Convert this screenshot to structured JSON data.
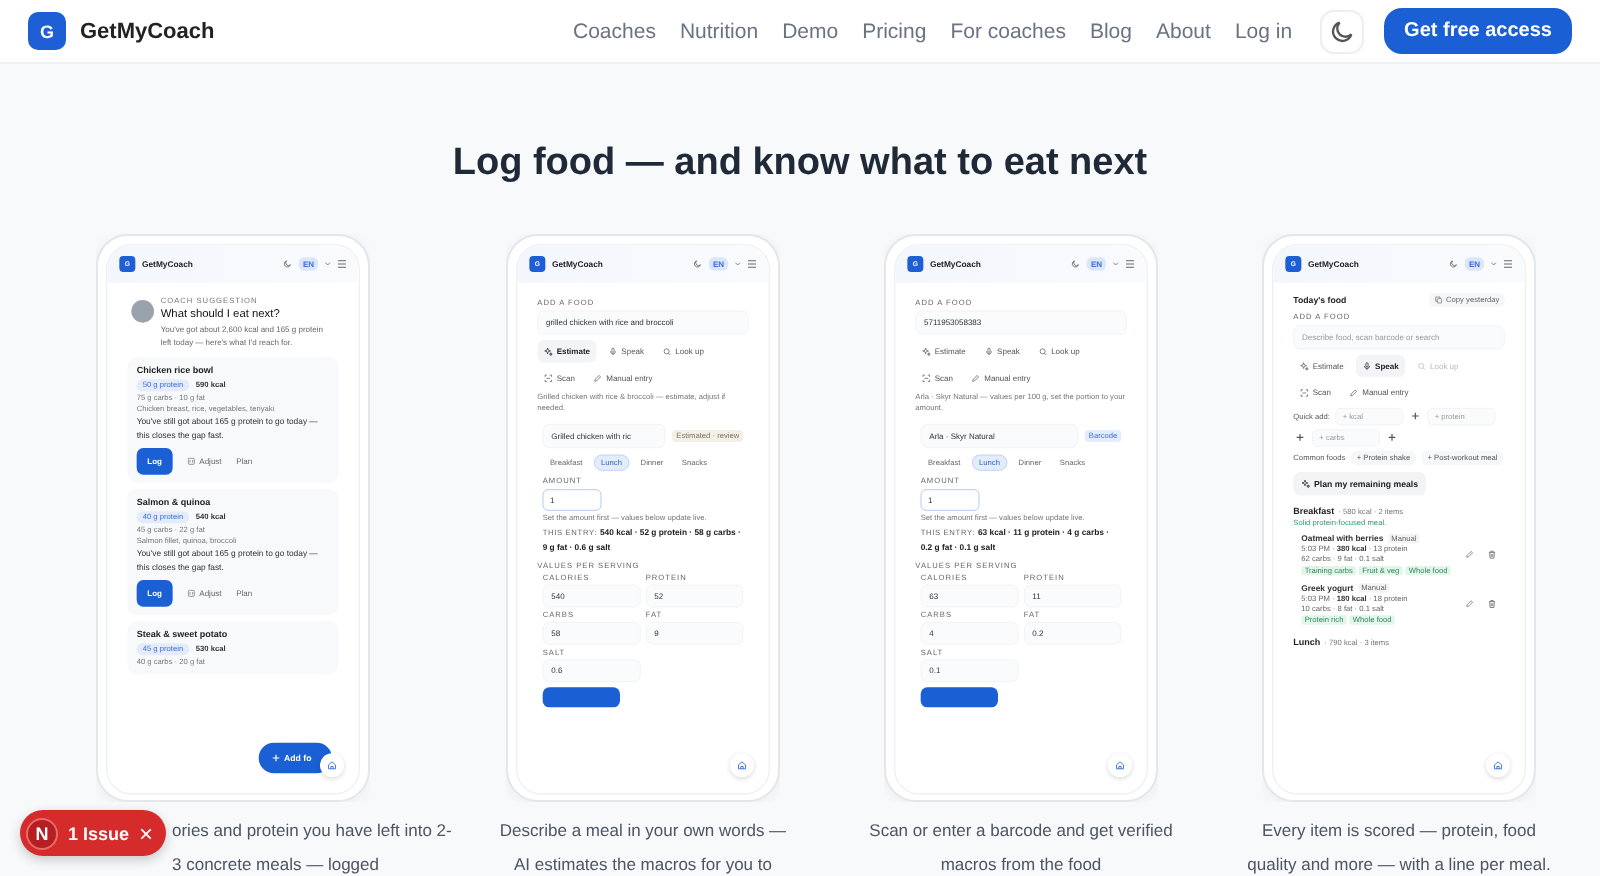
{
  "nav": {
    "logo": "G",
    "brand": "GetMyCoach",
    "links": [
      "Coaches",
      "Nutrition",
      "Demo",
      "Pricing",
      "For coaches",
      "Blog",
      "About",
      "Log in"
    ],
    "cta": "Get free access"
  },
  "heading": "Log food — and know what to eat next",
  "phones": [
    {
      "logo": "G",
      "brand": "GetMyCoach",
      "lang": "EN",
      "caption": "ories and protein you have left into 2-3 concrete meals — logged",
      "fab": "Add fo",
      "blocks": [
        {
          "kind": "coach",
          "eyebrow": "COACH SUGGESTION",
          "title": "What should I eat next?",
          "text": "You've got about 2,600 kcal and 165 g protein left today — here's what I'd reach for."
        },
        {
          "kind": "meal",
          "name": "Chicken rice bowl",
          "protein": "50 g protein",
          "kcal": "590 kcal",
          "macros": "75 g carbs · 10 g fat",
          "ingredients": "Chicken breast, rice, vegetables, teriyaki",
          "note": "You've still got about 165 g protein to go today — this closes the gap fast.",
          "actions": [
            "Log",
            "Adjust",
            "Plan"
          ]
        },
        {
          "kind": "meal",
          "name": "Salmon & quinoa",
          "protein": "40 g protein",
          "kcal": "540 kcal",
          "macros": "45 g carbs · 22 g fat",
          "ingredients": "Salmon fillet, quinoa, broccoli",
          "note": "You've still got about 165 g protein to go today — this closes the gap fast.",
          "actions": [
            "Log",
            "Adjust",
            "Plan"
          ]
        },
        {
          "kind": "meal",
          "name": "Steak & sweet potato",
          "protein": "45 g protein",
          "kcal": "530 kcal",
          "macros": "40 g carbs · 20 g fat"
        }
      ]
    },
    {
      "logo": "G",
      "brand": "GetMyCoach",
      "lang": "EN",
      "caption": "Describe a meal in your own words — AI estimates the macros for you to",
      "blocks": [
        {
          "kind": "label",
          "text": "ADD A FOOD"
        },
        {
          "kind": "input",
          "value": "grilled chicken with rice and broccoli"
        },
        {
          "kind": "actions",
          "items": [
            {
              "label": "Estimate",
              "selected": true,
              "disabled": false
            },
            {
              "label": "Speak",
              "selected": false,
              "disabled": false
            },
            {
              "label": "Look up",
              "selected": false,
              "disabled": false
            },
            {
              "label": "Scan",
              "selected": false,
              "disabled": false
            },
            {
              "label": "Manual entry",
              "selected": false,
              "disabled": false
            }
          ]
        },
        {
          "kind": "note",
          "text": "Grilled chicken with rice & broccoli — estimate, adjust if needed."
        },
        {
          "kind": "item",
          "name": "Grilled chicken with ric",
          "badge": {
            "kind": "estimate",
            "text": "Estimated · review"
          }
        },
        {
          "kind": "chips",
          "items": [
            {
              "label": "Breakfast",
              "selected": false
            },
            {
              "label": "Lunch",
              "selected": true
            },
            {
              "label": "Dinner",
              "selected": false
            },
            {
              "label": "Snacks",
              "selected": false
            }
          ]
        },
        {
          "kind": "amount",
          "label": "AMOUNT",
          "value": "1",
          "hint": "Set the amount first — values below update live."
        },
        {
          "kind": "entry",
          "text": "THIS ENTRY: **540 kcal · 52 g protein · 58 g carbs · 9 g fat · 0.6 g salt**"
        },
        {
          "kind": "label",
          "text": "VALUES PER SERVING"
        },
        {
          "kind": "fields",
          "items": [
            {
              "label": "CALORIES",
              "value": "540"
            },
            {
              "label": "PROTEIN",
              "value": "52"
            },
            {
              "label": "CARBS",
              "value": "58"
            },
            {
              "label": "FAT",
              "value": "9"
            },
            {
              "label": "SALT",
              "value": "0.6"
            }
          ]
        },
        {
          "kind": "submit"
        }
      ]
    },
    {
      "logo": "G",
      "brand": "GetMyCoach",
      "lang": "EN",
      "caption": "Scan or enter a barcode and get verified macros from the food",
      "blocks": [
        {
          "kind": "label",
          "text": "ADD A FOOD"
        },
        {
          "kind": "input",
          "value": "5711953058383"
        },
        {
          "kind": "actions",
          "items": [
            {
              "label": "Estimate",
              "selected": false,
              "disabled": false
            },
            {
              "label": "Speak",
              "selected": false,
              "disabled": false
            },
            {
              "label": "Look up",
              "selected": false,
              "disabled": false
            },
            {
              "label": "Scan",
              "selected": false,
              "disabled": false
            },
            {
              "label": "Manual entry",
              "selected": false,
              "disabled": false
            }
          ]
        },
        {
          "kind": "note",
          "text": "Arla · Skyr Natural — values per 100 g, set the portion to your amount."
        },
        {
          "kind": "item",
          "name": "Arla · Skyr Natural",
          "badge": {
            "kind": "barcode",
            "text": "Barcode"
          }
        },
        {
          "kind": "chips",
          "items": [
            {
              "label": "Breakfast",
              "selected": false
            },
            {
              "label": "Lunch",
              "selected": true
            },
            {
              "label": "Dinner",
              "selected": false
            },
            {
              "label": "Snacks",
              "selected": false
            }
          ]
        },
        {
          "kind": "amount",
          "label": "AMOUNT",
          "value": "1",
          "hint": "Set the amount first — values below update live."
        },
        {
          "kind": "entry",
          "text": "THIS ENTRY: **63 kcal · 11 g protein · 4 g carbs · 0.2 g fat · 0.1 g salt**"
        },
        {
          "kind": "label",
          "text": "VALUES PER SERVING"
        },
        {
          "kind": "fields",
          "items": [
            {
              "label": "CALORIES",
              "value": "63"
            },
            {
              "label": "PROTEIN",
              "value": "11"
            },
            {
              "label": "CARBS",
              "value": "4"
            },
            {
              "label": "FAT",
              "value": "0.2"
            },
            {
              "label": "SALT",
              "value": "0.1"
            }
          ]
        },
        {
          "kind": "submit"
        }
      ]
    },
    {
      "logo": "G",
      "brand": "GetMyCoach",
      "lang": "EN",
      "caption": "Every item is scored — protein, food quality and more — with a line per meal.",
      "blocks": [
        {
          "kind": "today",
          "title": "Today's food",
          "action": "Copy yesterday"
        },
        {
          "kind": "label",
          "text": "ADD A FOOD"
        },
        {
          "kind": "input",
          "placeholder": "Describe food, scan barcode or search"
        },
        {
          "kind": "actions",
          "items": [
            {
              "label": "Estimate",
              "selected": false,
              "disabled": false
            },
            {
              "label": "Speak",
              "selected": true,
              "disabled": false
            },
            {
              "label": "Look up",
              "selected": false,
              "disabled": true
            },
            {
              "label": "Scan",
              "selected": false,
              "disabled": false
            },
            {
              "label": "Manual entry",
              "selected": false,
              "disabled": false
            }
          ]
        },
        {
          "kind": "quick",
          "label": "Quick add:",
          "fields": [
            "+ kcal",
            "+ protein",
            "+ carbs"
          ]
        },
        {
          "kind": "common",
          "label": "Common foods",
          "items": [
            "+ Protein shake",
            "+ Post-workout meal"
          ]
        },
        {
          "kind": "plan",
          "label": "Plan my remaining meals"
        },
        {
          "kind": "group",
          "name": "Breakfast",
          "summary": "· 580 kcal · 2 items",
          "comment": "Solid protein-focused meal.",
          "foods": [
            {
              "name": "Oatmeal with berries",
              "badge": "Manual",
              "line1": "5:03 PM · **380 kcal** · 13 protein",
              "line2": "62 carbs · 9 fat · 0.1 salt",
              "tags": [
                "Training carbs",
                "Fruit & veg",
                "Whole food"
              ]
            },
            {
              "name": "Greek yogurt",
              "badge": "Manual",
              "line1": "5:03 PM · **180 kcal** · 18 protein",
              "line2": "10 carbs · 8 fat · 0.1 salt",
              "tags": [
                "Protein rich",
                "Whole food"
              ]
            }
          ]
        },
        {
          "kind": "group",
          "name": "Lunch",
          "summary": "· 790 kcal · 3 items"
        }
      ]
    }
  ],
  "toast": {
    "logo": "N",
    "label": "1 Issue",
    "close": "×"
  }
}
